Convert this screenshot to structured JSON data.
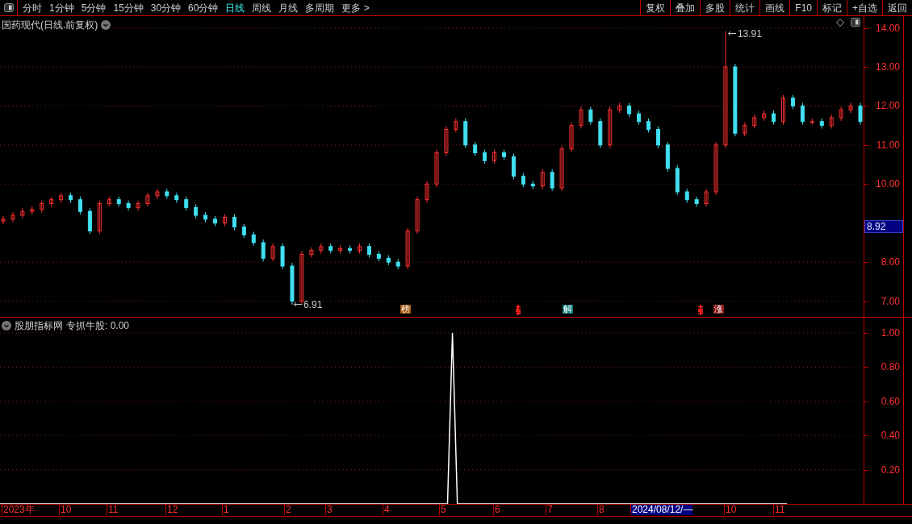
{
  "toolbar": {
    "periods": [
      {
        "label": "分时",
        "selected": false
      },
      {
        "label": "1分钟",
        "selected": false
      },
      {
        "label": "5分钟",
        "selected": false
      },
      {
        "label": "15分钟",
        "selected": false
      },
      {
        "label": "30分钟",
        "selected": false
      },
      {
        "label": "60分钟",
        "selected": false
      },
      {
        "label": "日线",
        "selected": true
      },
      {
        "label": "周线",
        "selected": false
      },
      {
        "label": "月线",
        "selected": false
      },
      {
        "label": "多周期",
        "selected": false
      },
      {
        "label": "更多 >",
        "selected": false
      }
    ],
    "buttons": [
      "复权",
      "叠加",
      "多股",
      "统计",
      "画线",
      "F10",
      "标记",
      "+自选",
      "返回"
    ]
  },
  "price_panel": {
    "title": "国药现代(日线.前复权)",
    "high_label": "13.91",
    "low_label": "6.91",
    "current_price": "8.92",
    "chart_data": {
      "type": "candlestick",
      "grid": true,
      "ylim": [
        6.6,
        14.3
      ],
      "yticks": [
        {
          "value": 14,
          "label": "14.00"
        },
        {
          "value": 13,
          "label": "13.00"
        },
        {
          "value": 12,
          "label": "12.00"
        },
        {
          "value": 11,
          "label": "11.00"
        },
        {
          "value": 10,
          "label": "10.00"
        },
        {
          "value": 8,
          "label": "8.00"
        },
        {
          "value": 7,
          "label": "7.00"
        }
      ],
      "ohlc": [
        [
          9.05,
          9.18,
          8.97,
          9.1
        ],
        [
          9.1,
          9.28,
          9.02,
          9.2
        ],
        [
          9.2,
          9.38,
          9.12,
          9.3
        ],
        [
          9.3,
          9.43,
          9.22,
          9.35
        ],
        [
          9.35,
          9.58,
          9.27,
          9.5
        ],
        [
          9.5,
          9.68,
          9.42,
          9.6
        ],
        [
          9.6,
          9.78,
          9.52,
          9.7
        ],
        [
          9.7,
          9.78,
          9.52,
          9.6
        ],
        [
          9.6,
          9.68,
          9.22,
          9.3
        ],
        [
          9.3,
          9.38,
          8.72,
          8.8
        ],
        [
          8.8,
          9.58,
          8.72,
          9.5
        ],
        [
          9.5,
          9.68,
          9.42,
          9.6
        ],
        [
          9.6,
          9.68,
          9.42,
          9.5
        ],
        [
          9.5,
          9.58,
          9.32,
          9.4
        ],
        [
          9.4,
          9.58,
          9.32,
          9.5
        ],
        [
          9.5,
          9.78,
          9.42,
          9.7
        ],
        [
          9.7,
          9.88,
          9.62,
          9.8
        ],
        [
          9.8,
          9.88,
          9.62,
          9.7
        ],
        [
          9.7,
          9.78,
          9.52,
          9.6
        ],
        [
          9.6,
          9.68,
          9.32,
          9.4
        ],
        [
          9.4,
          9.48,
          9.12,
          9.2
        ],
        [
          9.2,
          9.28,
          9.02,
          9.1
        ],
        [
          9.1,
          9.18,
          8.92,
          9.0
        ],
        [
          9.0,
          9.23,
          8.92,
          9.15
        ],
        [
          9.15,
          9.23,
          8.82,
          8.9
        ],
        [
          8.9,
          8.98,
          8.62,
          8.7
        ],
        [
          8.7,
          8.78,
          8.42,
          8.5
        ],
        [
          8.5,
          8.58,
          8.02,
          8.1
        ],
        [
          8.1,
          8.48,
          8.02,
          8.4
        ],
        [
          8.4,
          8.48,
          7.82,
          7.9
        ],
        [
          7.9,
          7.98,
          6.91,
          7.0
        ],
        [
          7.0,
          8.28,
          6.92,
          8.2
        ],
        [
          8.2,
          8.38,
          8.12,
          8.3
        ],
        [
          8.3,
          8.48,
          8.22,
          8.4
        ],
        [
          8.4,
          8.48,
          8.22,
          8.3
        ],
        [
          8.3,
          8.43,
          8.22,
          8.35
        ],
        [
          8.35,
          8.43,
          8.22,
          8.3
        ],
        [
          8.3,
          8.48,
          8.22,
          8.4
        ],
        [
          8.4,
          8.48,
          8.12,
          8.2
        ],
        [
          8.2,
          8.28,
          8.02,
          8.1
        ],
        [
          8.1,
          8.18,
          7.92,
          8.0
        ],
        [
          8.0,
          8.08,
          7.82,
          7.9
        ],
        [
          7.9,
          8.88,
          7.82,
          8.8
        ],
        [
          8.8,
          9.68,
          8.72,
          9.6
        ],
        [
          9.6,
          10.08,
          9.52,
          10.0
        ],
        [
          10.0,
          10.88,
          9.92,
          10.8
        ],
        [
          10.8,
          11.48,
          10.72,
          11.4
        ],
        [
          11.4,
          11.68,
          11.32,
          11.6
        ],
        [
          11.6,
          11.68,
          10.92,
          11.0
        ],
        [
          11.0,
          11.08,
          10.72,
          10.8
        ],
        [
          10.8,
          10.88,
          10.52,
          10.6
        ],
        [
          10.6,
          10.88,
          10.52,
          10.8
        ],
        [
          10.8,
          10.88,
          10.62,
          10.7
        ],
        [
          10.7,
          10.78,
          10.12,
          10.2
        ],
        [
          10.2,
          10.28,
          9.92,
          10.0
        ],
        [
          10.0,
          10.08,
          9.87,
          9.95
        ],
        [
          9.95,
          10.38,
          9.87,
          10.3
        ],
        [
          10.3,
          10.38,
          9.82,
          9.9
        ],
        [
          9.9,
          10.98,
          9.82,
          10.9
        ],
        [
          10.9,
          11.58,
          10.82,
          11.5
        ],
        [
          11.5,
          11.98,
          11.42,
          11.9
        ],
        [
          11.9,
          11.98,
          11.52,
          11.6
        ],
        [
          11.6,
          11.68,
          10.92,
          11.0
        ],
        [
          11.0,
          11.98,
          10.92,
          11.9
        ],
        [
          11.9,
          12.08,
          11.82,
          12.0
        ],
        [
          12.0,
          12.08,
          11.72,
          11.8
        ],
        [
          11.8,
          11.88,
          11.52,
          11.6
        ],
        [
          11.6,
          11.68,
          11.32,
          11.4
        ],
        [
          11.4,
          11.48,
          10.92,
          11.0
        ],
        [
          11.0,
          11.08,
          10.32,
          10.4
        ],
        [
          10.4,
          10.48,
          9.72,
          9.8
        ],
        [
          9.8,
          9.88,
          9.52,
          9.6
        ],
        [
          9.6,
          9.68,
          9.42,
          9.5
        ],
        [
          9.5,
          9.88,
          9.42,
          9.8
        ],
        [
          9.8,
          11.08,
          9.72,
          11.0
        ],
        [
          11.0,
          13.91,
          10.92,
          13.0
        ],
        [
          13.0,
          13.08,
          11.22,
          11.3
        ],
        [
          11.3,
          11.58,
          11.22,
          11.5
        ],
        [
          11.5,
          11.78,
          11.42,
          11.7
        ],
        [
          11.7,
          11.88,
          11.62,
          11.8
        ],
        [
          11.8,
          11.88,
          11.52,
          11.6
        ],
        [
          11.6,
          12.28,
          11.52,
          12.2
        ],
        [
          12.2,
          12.28,
          11.92,
          12.0
        ],
        [
          12.0,
          12.08,
          11.52,
          11.6
        ],
        [
          11.6,
          11.68,
          11.52,
          11.6
        ],
        [
          11.6,
          11.68,
          11.42,
          11.5
        ],
        [
          11.5,
          11.78,
          11.42,
          11.7
        ],
        [
          11.7,
          11.98,
          11.62,
          11.9
        ],
        [
          11.9,
          12.08,
          11.82,
          12.0
        ],
        [
          12.0,
          12.08,
          11.52,
          11.6
        ]
      ]
    },
    "markers": [
      {
        "kind": "tag",
        "text": "榜",
        "color": "#a0520a"
      },
      {
        "kind": "icon",
        "color": "#ff2020"
      },
      {
        "kind": "tag",
        "text": "解",
        "color": "#0f7f7f"
      },
      {
        "kind": "icon",
        "color": "#ff2020"
      },
      {
        "kind": "tag",
        "text": "涨",
        "color": "#8a1010"
      }
    ]
  },
  "indicator_panel": {
    "title": "股朋指标网",
    "reading": "专抓牛股: 0.00",
    "chart_data": {
      "type": "line",
      "grid": true,
      "ylim": [
        0,
        1
      ],
      "yticks": [
        {
          "value": 1,
          "label": "1.00"
        },
        {
          "value": 0.8,
          "label": "0.80"
        },
        {
          "value": 0.6,
          "label": "0.60"
        },
        {
          "value": 0.4,
          "label": "0.40"
        },
        {
          "value": 0.2,
          "label": "0.20"
        }
      ],
      "series": [
        {
          "color": "#ffffff",
          "values": [
            0,
            0,
            0,
            0,
            0,
            0,
            0,
            0,
            0,
            0,
            0,
            0,
            0,
            0,
            0,
            0,
            0,
            0,
            0,
            0,
            0,
            0,
            0,
            0,
            0,
            0,
            0,
            0,
            0,
            0,
            0,
            0,
            0,
            0,
            0,
            0,
            0,
            0,
            0,
            0,
            0,
            0,
            0,
            0,
            0,
            0,
            0,
            0,
            0,
            0,
            0,
            0,
            0,
            0,
            0,
            0,
            0,
            0,
            0,
            0,
            0,
            0,
            0,
            0,
            0,
            0,
            0,
            0,
            0,
            0,
            0,
            0,
            0,
            0,
            0,
            0,
            0,
            0,
            0,
            0,
            0,
            0,
            0,
            0,
            0,
            0,
            0,
            0,
            0,
            0,
            0,
            0,
            1,
            0,
            0,
            0,
            0,
            0,
            0,
            0,
            0,
            0,
            0,
            0,
            0,
            0,
            0,
            0,
            0,
            0,
            0,
            0,
            0,
            0,
            0,
            0,
            0,
            0,
            0,
            0,
            0,
            0,
            0,
            0,
            0,
            0,
            0,
            0,
            0,
            0,
            0,
            0,
            0,
            0,
            0,
            0,
            0,
            0,
            0,
            0,
            0,
            0,
            0,
            0,
            0,
            0,
            0,
            0,
            0,
            0,
            0,
            0,
            0,
            0,
            0,
            0,
            0,
            0,
            0,
            0,
            0
          ]
        }
      ]
    }
  },
  "x_axis": {
    "labels": [
      {
        "text": "2023年",
        "selected": false
      },
      {
        "text": "10",
        "selected": false
      },
      {
        "text": "11",
        "selected": false
      },
      {
        "text": "12",
        "selected": false
      },
      {
        "text": "1",
        "selected": false
      },
      {
        "text": "2",
        "selected": false
      },
      {
        "text": "3",
        "selected": false
      },
      {
        "text": "4",
        "selected": false
      },
      {
        "text": "5",
        "selected": false
      },
      {
        "text": "6",
        "selected": false
      },
      {
        "text": "7",
        "selected": false
      },
      {
        "text": "8",
        "selected": false
      },
      {
        "text": "2024/08/12/—",
        "selected": true
      },
      {
        "text": "10",
        "selected": false
      },
      {
        "text": "11",
        "selected": false
      }
    ]
  }
}
